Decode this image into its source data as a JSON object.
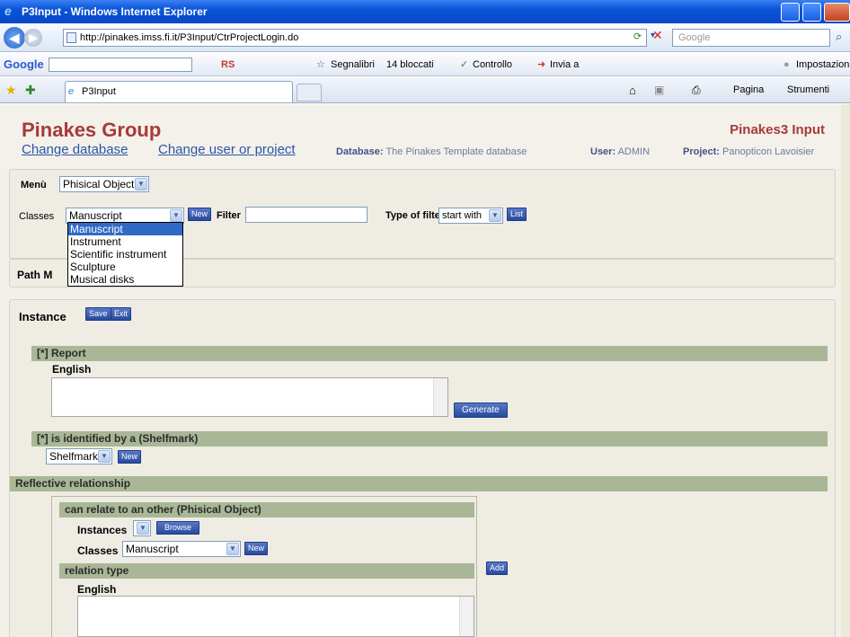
{
  "window": {
    "title": "P3Input - Windows Internet Explorer"
  },
  "address": {
    "url": "http://pinakes.imss.fi.it/P3Input/CtrProjectLogin.do",
    "search_placeholder": "Google"
  },
  "gtoolbar": {
    "google": "Google",
    "rs": "RS",
    "bookmarks": "Segnalibri",
    "blocked": "14 bloccati",
    "check": "Controllo",
    "send": "Invia a",
    "settings": "Impostazioni"
  },
  "tabs": {
    "active": "P3Input",
    "page": "Pagina",
    "tools": "Strumenti"
  },
  "header": {
    "brand": "Pinakes Group",
    "product": "Pinakes3 Input",
    "change_db": "Change database",
    "change_user": "Change user or project",
    "db_label": "Database:",
    "db_value": "The Pinakes Template database",
    "user_label": "User:",
    "user_value": "ADMIN",
    "proj_label": "Project:",
    "proj_value": "Panopticon Lavoisier"
  },
  "menu": {
    "label": "Menù",
    "value": "Phisical Object",
    "classes_label": "Classes",
    "classes_value": "Manuscript",
    "new": "New",
    "filter_label": "Filter",
    "type_label": "Type of filter",
    "type_value": "start with",
    "list": "List"
  },
  "dropdown_options": [
    "Manuscript",
    "Instrument",
    "Scientific instrument",
    "Sculpture",
    "Musical disks"
  ],
  "path": {
    "label": "Path M"
  },
  "instance": {
    "title": "Instance",
    "save": "Save",
    "exit": "Exit",
    "report": "[*] Report",
    "english": "English",
    "generate": "Generate",
    "identified": "[*] is identified by a (Shelfmark)",
    "shelfmark": "Shelfmark",
    "new": "New",
    "reflective": "Reflective relationship",
    "relate": "can relate to an other (Phisical Object)",
    "instances": "Instances",
    "browse": "Browse",
    "classes": "Classes",
    "classes_value": "Manuscript",
    "relation_type": "relation type",
    "add": "Add",
    "english2": "English"
  }
}
